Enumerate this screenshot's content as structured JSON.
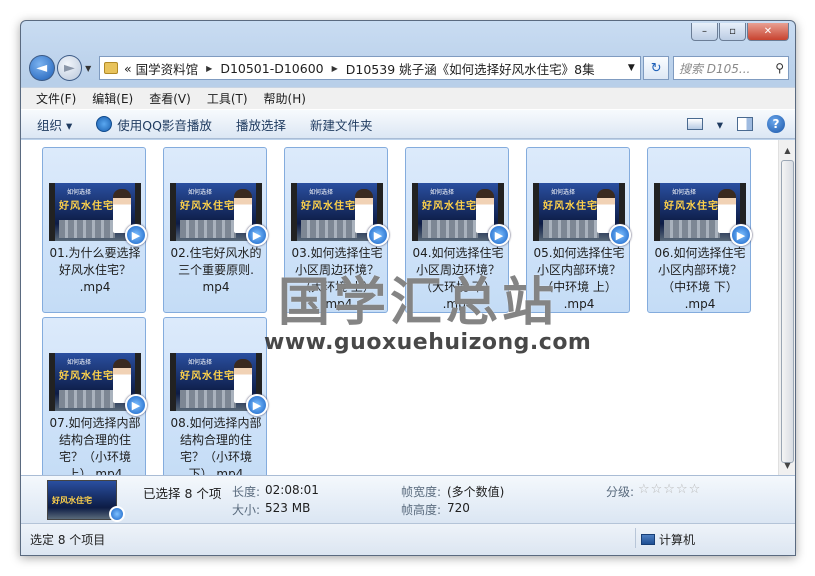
{
  "window": {
    "buttons": {
      "minimize": "–",
      "maximize": "▫",
      "close": "✕"
    }
  },
  "nav": {
    "back": "◄",
    "forward": "►",
    "history_dropdown": "▼",
    "overflow": "«",
    "breadcrumbs": [
      "国学资料馆",
      "D10501-D10600",
      "D10539 姚子涵《如何选择好风水住宅》8集"
    ],
    "address_dropdown": "▼",
    "refresh": "↻",
    "search_placeholder": "搜索 D105...",
    "search_icon": "⚲"
  },
  "menubar": [
    "文件(F)",
    "编辑(E)",
    "查看(V)",
    "工具(T)",
    "帮助(H)"
  ],
  "toolbar": {
    "organize": "组织 ▾",
    "play_with_qq": "使用QQ影音播放",
    "burn": "播放选择",
    "new_folder": "新建文件夹",
    "view_dropdown": "▾",
    "help": "?"
  },
  "thumbnail": {
    "small_title": "如何选择",
    "big_title": "好风水住宅"
  },
  "files": [
    {
      "lines": [
        "01.为什么要选择",
        "好风水住宅？",
        ".mp4"
      ]
    },
    {
      "lines": [
        "02.住宅好风水的",
        "三个重要原则.",
        "mp4"
      ]
    },
    {
      "lines": [
        "03.如何选择住宅",
        "小区周边环境？",
        "（大环境 上）",
        ".mp4"
      ]
    },
    {
      "lines": [
        "04.如何选择住宅",
        "小区周边环境？",
        "（大环境 下）",
        ".mp4"
      ]
    },
    {
      "lines": [
        "05.如何选择住宅",
        "小区内部环境？",
        "（中环境 上）",
        ".mp4"
      ]
    },
    {
      "lines": [
        "06.如何选择住宅",
        "小区内部环境？",
        "（中环境 下）",
        ".mp4"
      ]
    },
    {
      "lines": [
        "07.如何选择内部",
        "结构合理的住",
        "宅？（小环境",
        "上）.mp4"
      ]
    },
    {
      "lines": [
        "08.如何选择内部",
        "结构合理的住",
        "宅？（小环境",
        "下）.mp4"
      ]
    }
  ],
  "watermark": {
    "cn": "国学汇总站",
    "url": "www.guoxuehuizong.com"
  },
  "details": {
    "selected": "已选择 8 个项",
    "length_key": "长度:",
    "length_val": "02:08:01",
    "size_key": "大小:",
    "size_val": "523 MB",
    "width_key": "帧宽度:",
    "width_val": "(多个数值)",
    "height_key": "帧高度:",
    "height_val": "720",
    "rating_key": "分级:",
    "rating_stars": "☆☆☆☆☆",
    "thumb_title": "好风水住宅"
  },
  "status": {
    "left": "选定 8 个项目",
    "right": "计算机"
  },
  "scroll": {
    "up": "▲",
    "down": "▼"
  }
}
